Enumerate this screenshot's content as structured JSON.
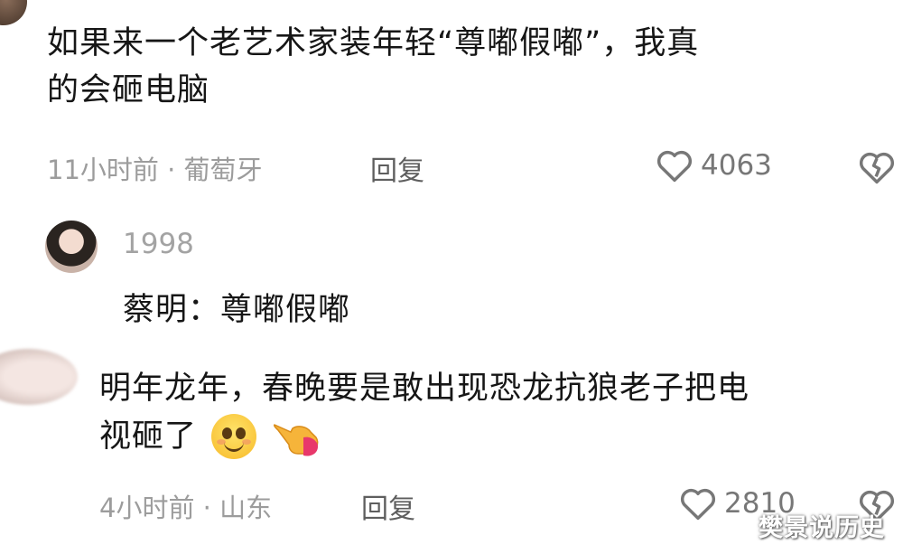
{
  "comment1": {
    "text_line1": "如果来一个老艺术家装年轻“尊嘟假嘟”，我真",
    "text_line2": "的会砸电脑",
    "meta": "11小时前 · 葡萄牙",
    "reply_label": "回复",
    "likes": "4063",
    "like_icon": "heart-outline-icon",
    "dislike_icon": "broken-heart-icon"
  },
  "reply": {
    "username": "1998",
    "text": "蔡明：尊嘟假嘟"
  },
  "comment2": {
    "text_line1": "明年龙年，春晚要是敢出现恐龙抗狼老子把电",
    "text_line2": "视砸了",
    "emojis": [
      "smiling-face-emoji",
      "pointing-hand-emoji"
    ],
    "meta": "4小时前 · 山东",
    "reply_label": "回复",
    "likes": "2810",
    "like_icon": "heart-outline-icon",
    "dislike_icon": "broken-heart-icon"
  },
  "watermark": "樊景说历史"
}
